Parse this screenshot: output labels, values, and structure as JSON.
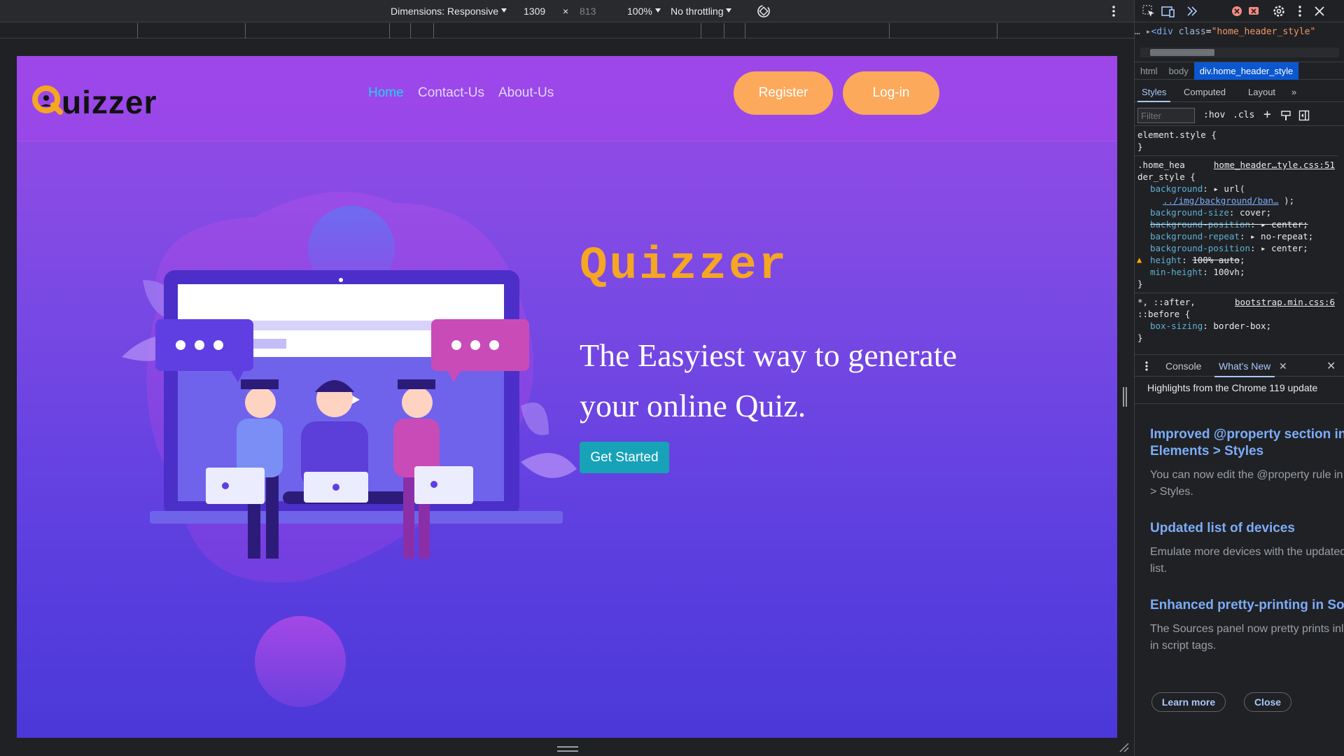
{
  "device_toolbar": {
    "dimensions_label": "Dimensions: Responsive",
    "width": "1309",
    "times": "×",
    "height": "813",
    "zoom": "100%",
    "throttling": "No throttling"
  },
  "site": {
    "logo_text": "Quizzer",
    "nav": {
      "home": "Home",
      "contact": "Contact-Us",
      "about": "About-Us"
    },
    "register": "Register",
    "login": "Log-in",
    "hero_title": "Quizzer",
    "tagline": "The Easyiest way to generate your online Quiz.",
    "cta": "Get Started"
  },
  "devtools": {
    "dom": {
      "prefix": "<div ",
      "attr": "class",
      "eq": "=",
      "value": "\"home_header_style\""
    },
    "breadcrumbs": [
      "html",
      "body",
      "div.home_header_style"
    ],
    "tabs": {
      "styles": "Styles",
      "computed": "Computed",
      "layout": "Layout"
    },
    "filter_placeholder": "Filter",
    "hov": ":hov",
    "cls": ".cls",
    "rules": {
      "element_style_sel": "element.style {",
      "close": "}",
      "r2_sel_a": ".home_hea",
      "r2_sel_b": "der_style {",
      "r2_src": "home_header…tyle.css:51",
      "background_prop": "background",
      "background_val_a": "url(",
      "background_val_b": "../img/background/ban…",
      "background_val_c": ");",
      "bgsize_prop": "background-size",
      "bgsize_val": "cover;",
      "bgpos1_prop": "background-position",
      "bgpos1_val": "center;",
      "bgrepeat_prop": "background-repeat",
      "bgrepeat_val": "no-repeat;",
      "bgpos2_prop": "background-position",
      "bgpos2_val": "center;",
      "height_prop": "height",
      "height_val": "100% auto",
      "minh_prop": "min-height",
      "minh_val": "100vh;",
      "r3_sel_a": "*, ::after,",
      "r3_sel_b": "::before {",
      "r3_src": "bootstrap.min.css:6",
      "boxsizing_prop": "box-sizing",
      "boxsizing_val": "border-box;"
    },
    "drawer": {
      "console": "Console",
      "whats_new": "What's New",
      "header": "Highlights from the Chrome 119 update",
      "items": [
        {
          "title": "Improved @property section in Elements > Styles",
          "desc1": "You can now edit the @property rule in Elements",
          "desc2": "> Styles."
        },
        {
          "title": "Updated list of devices",
          "desc1": "Emulate more devices with the updated device",
          "desc2": "list."
        },
        {
          "title": "Enhanced pretty-printing in Sources",
          "desc1": "The Sources panel now pretty prints inline JS",
          "desc2": "in script tags."
        }
      ],
      "learn_more": "Learn more",
      "close": "Close"
    }
  },
  "colors": {
    "brand_orange": "#f5a623",
    "button_orange": "#fca95b",
    "cta_teal": "#17a2b8",
    "nav_active": "#22d3ee",
    "devtools_link": "#7cacf8"
  }
}
